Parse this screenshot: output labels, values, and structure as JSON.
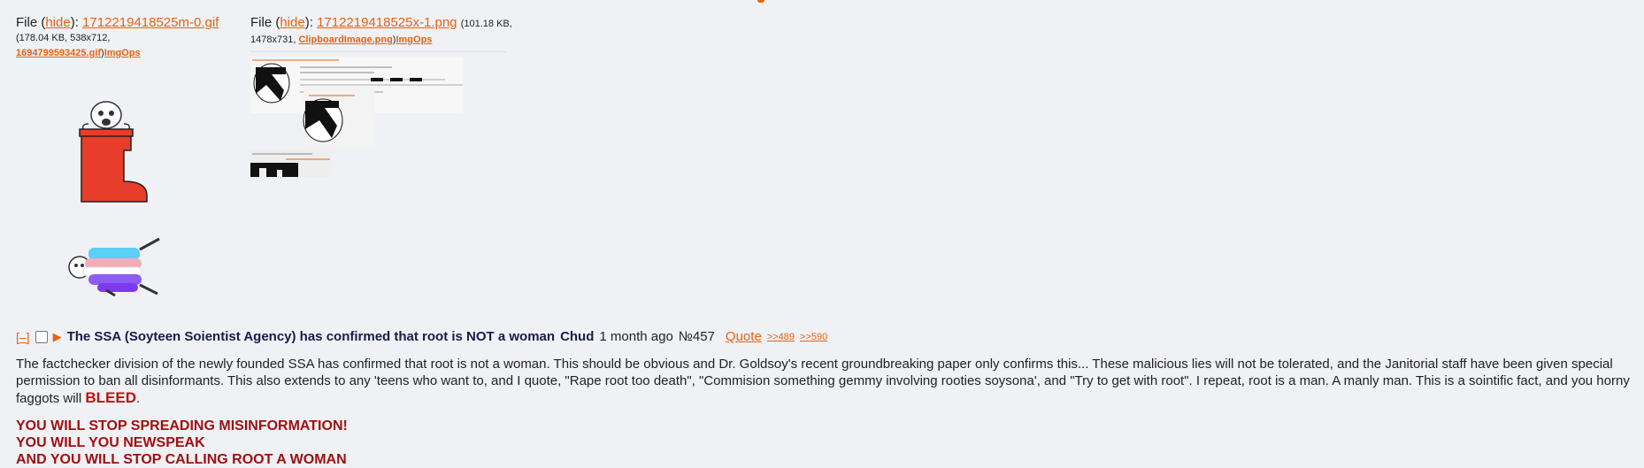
{
  "file1": {
    "prefix": "File (",
    "hide": "hide",
    "suffix": "):",
    "name": "1712219418525m-0.gif",
    "meta_line1": "(178.04 KB, 538x712,",
    "orig_name": "1694799593425.gif",
    "sep": ")",
    "imgops": "ImgOps"
  },
  "file2": {
    "prefix": "File (",
    "hide": "hide",
    "suffix": "):",
    "name": "1712219418525x-1.png",
    "meta_inline": "(101.18 KB,",
    "meta_line2": "1478x731,",
    "orig_name": "ClipboardImage.png",
    "sep": ")",
    "imgops": "ImgOps"
  },
  "post": {
    "hide_btn": "[–]",
    "subject": "The SSA (Soyteen Soientist Agency) has confirmed that root is NOT a woman",
    "author": "Chud",
    "time": "1 month ago",
    "number": "№457",
    "quote": "Quote",
    "replies": [
      ">>489",
      ">>590"
    ],
    "body_part1": "The factchecker division of the newly founded SSA has confirmed that root is not a woman. This should be obvious and Dr. Goldsoy's recent groundbreaking paper only confirms this... These malicious lies will not be tolerated, and the Janitorial staff have been given special permission to ban all disinformants. This also extends to any 'teens who want to, and I quote, \"Rape root too death\", \"Commision something gemmy involving rooties soysona', and \"Try to get with root\". I repeat, root is a man. A manly man. This is a sointific fact, and you horny faggots will",
    "bleed": "BLEED",
    "body_end": ".",
    "shout_lines": [
      "YOU WILL STOP SPREADING MISINFORMATION!",
      "YOU WILL YOU NEWSPEAK",
      "AND YOU WILL STOP CALLING ROOT A WOMAN"
    ]
  },
  "colors": {
    "link": "#e8620f",
    "background": "#f0f1f5",
    "subject": "#1a1a4a",
    "bleed": "#c01010",
    "shout": "#a01010"
  }
}
